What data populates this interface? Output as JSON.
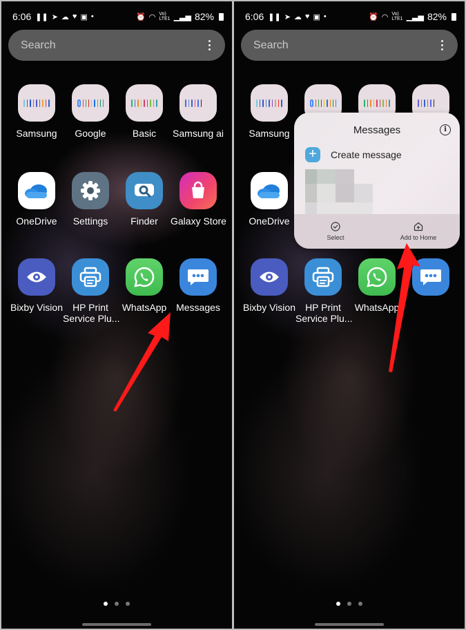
{
  "status_bar": {
    "time": "6:06",
    "notification_icons": [
      "pause-icon",
      "telegram-icon",
      "cloud-app-icon",
      "twitter-icon",
      "gallery-icon",
      "dot-icon"
    ],
    "system_icons": [
      "alarm-icon",
      "wifi-icon",
      "volte-lte1-icon",
      "signal-icon"
    ],
    "volte_label": "VoLTE1",
    "battery": "82%"
  },
  "search": {
    "placeholder": "Search"
  },
  "apps": [
    {
      "label": "Samsung",
      "type": "folder",
      "icon": "samsung-folder-icon"
    },
    {
      "label": "Google",
      "type": "folder",
      "icon": "google-folder-icon"
    },
    {
      "label": "Basic",
      "type": "folder",
      "icon": "basic-folder-icon"
    },
    {
      "label": "Samsung ai",
      "type": "folder",
      "icon": "samsung-ai-folder-icon"
    },
    {
      "label": "OneDrive",
      "type": "app",
      "icon": "onedrive-icon"
    },
    {
      "label": "Settings",
      "type": "app",
      "icon": "settings-icon"
    },
    {
      "label": "Finder",
      "type": "app",
      "icon": "finder-icon"
    },
    {
      "label": "Galaxy Store",
      "type": "app",
      "icon": "galaxy-store-icon"
    },
    {
      "label": "Bixby Vision",
      "type": "app",
      "icon": "bixby-vision-icon"
    },
    {
      "label": "HP Print Service Plu...",
      "type": "app",
      "icon": "hp-print-icon"
    },
    {
      "label": "WhatsApp",
      "type": "app",
      "icon": "whatsapp-icon"
    },
    {
      "label": "Messages",
      "type": "app",
      "icon": "messages-icon"
    }
  ],
  "hp_label_line1": "HP Print",
  "hp_label_line2": "Service Plu...",
  "context_menu": {
    "title": "Messages",
    "shortcut": "Create message",
    "actions": [
      {
        "label": "Select",
        "icon": "check-circle-icon"
      },
      {
        "label": "Add to Home",
        "icon": "add-home-icon"
      }
    ]
  },
  "page_indicator": {
    "pages": 3,
    "current": 1
  },
  "colors": {
    "annotation_arrow": "#ff1a1a",
    "search_bg": "#5a5a5a",
    "popup_bg": "#efe9ec"
  }
}
